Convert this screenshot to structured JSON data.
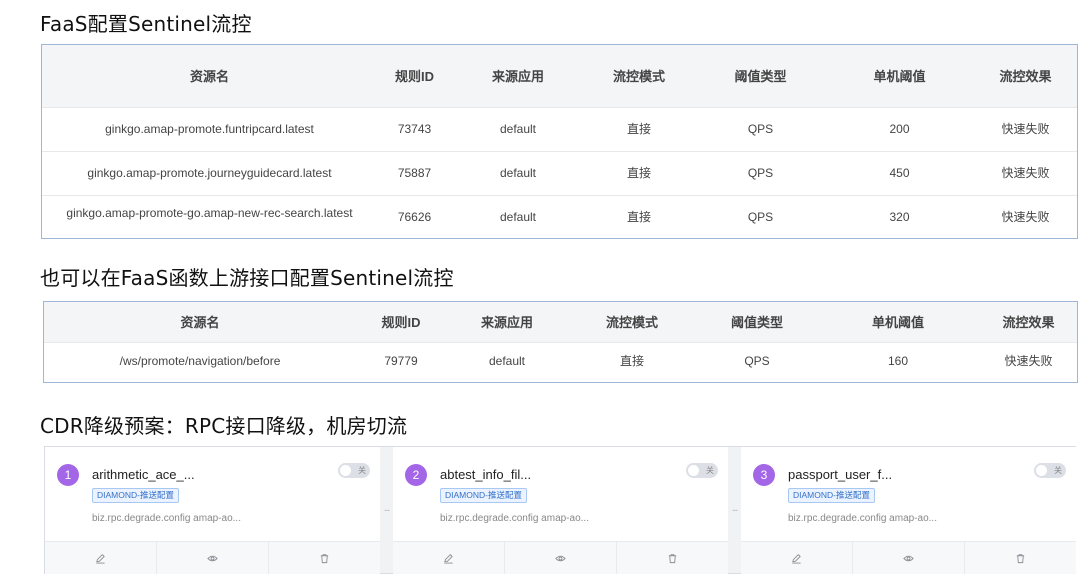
{
  "sections": {
    "faas_title": "FaaS配置Sentinel流控",
    "upstream_title": "也可以在FaaS函数上游接口配置Sentinel流控",
    "cdr_title": "CDR降级预案：RPC接口降级，机房切流"
  },
  "columns": [
    "资源名",
    "规则ID",
    "来源应用",
    "流控模式",
    "阈值类型",
    "单机阈值",
    "流控效果"
  ],
  "table1_rows": [
    [
      "ginkgo.amap-promote.funtripcard.latest",
      "73743",
      "default",
      "直接",
      "QPS",
      "200",
      "快速失败"
    ],
    [
      "ginkgo.amap-promote.journeyguidecard.latest",
      "75887",
      "default",
      "直接",
      "QPS",
      "450",
      "快速失败"
    ],
    [
      "ginkgo.amap-promote-go.amap-new-rec-search.latest",
      "76626",
      "default",
      "直接",
      "QPS",
      "320",
      "快速失败"
    ]
  ],
  "table2_rows": [
    [
      "/ws/promote/navigation/before",
      "79779",
      "default",
      "直接",
      "QPS",
      "160",
      "快速失败"
    ]
  ],
  "cards": [
    {
      "index": "1",
      "name": "arithmetic_ace_...",
      "tag": "DIAMOND-推送配置",
      "desc": "biz.rpc.degrade.config amap-ao...",
      "toggle_label": "关"
    },
    {
      "index": "2",
      "name": "abtest_info_fil...",
      "tag": "DIAMOND-推送配置",
      "desc": "biz.rpc.degrade.config amap-ao...",
      "toggle_label": "关"
    },
    {
      "index": "3",
      "name": "passport_user_f...",
      "tag": "DIAMOND-推送配置",
      "desc": "biz.rpc.degrade.config amap-ao...",
      "toggle_label": "关"
    }
  ],
  "separator_glyph": "...",
  "icons": {
    "edit": "edit-icon",
    "view": "eye-icon",
    "delete": "trash-icon"
  },
  "colors": {
    "badge_purple": "#a366e6",
    "tag_blue": "#3470c9",
    "table_border": "#9fb6d8"
  }
}
